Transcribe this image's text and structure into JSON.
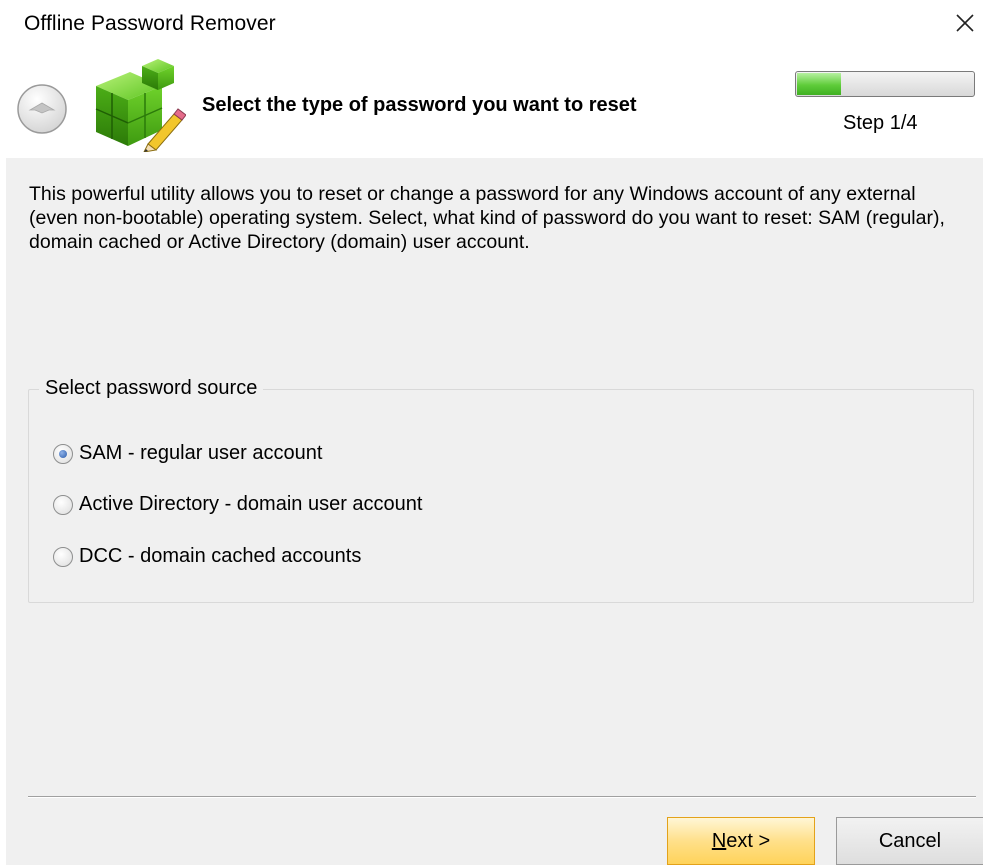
{
  "window": {
    "title": "Offline Password Remover",
    "close_icon": "close-icon"
  },
  "header": {
    "back_icon": "back-arrow-icon",
    "logo_icon": "registry-cubes-pencil-icon",
    "title": "Select the type of password you want to reset",
    "progress_fraction": 0.25,
    "step_label": "Step 1/4"
  },
  "main": {
    "description": "This powerful utility allows you to reset or change a password for any Windows account of any external (even non-bootable) operating system. Select, what kind of password do you want to reset: SAM (regular), domain cached or Active Directory (domain) user account.",
    "group_label": "Select password source",
    "options": [
      {
        "label": "SAM - regular user account",
        "checked": true
      },
      {
        "label": "Active Directory - domain user account",
        "checked": false
      },
      {
        "label": "DCC - domain cached accounts",
        "checked": false
      }
    ]
  },
  "buttons": {
    "next": "Next >",
    "cancel": "Cancel"
  },
  "colors": {
    "accent_green": "#3fb021",
    "next_button": "#ffd35a",
    "panel_bg": "#f0f0f0"
  }
}
